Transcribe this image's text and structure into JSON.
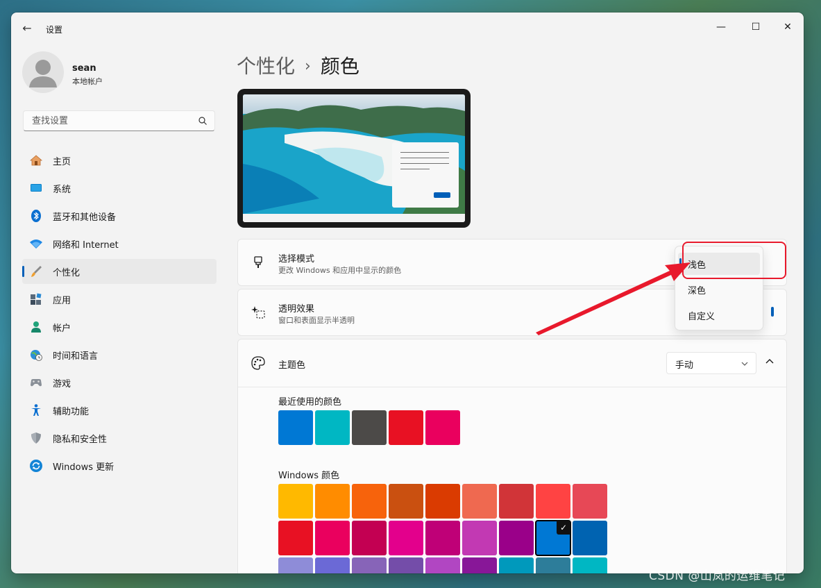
{
  "window": {
    "title": "设置",
    "back_glyph": "←",
    "minimize_glyph": "—",
    "maximize_glyph": "☐",
    "close_glyph": "✕"
  },
  "user": {
    "name": "sean",
    "account_type": "本地帐户"
  },
  "search": {
    "placeholder": "查找设置"
  },
  "sidebar": {
    "items": [
      {
        "label": "主页",
        "icon": "home-icon"
      },
      {
        "label": "系统",
        "icon": "display-icon"
      },
      {
        "label": "蓝牙和其他设备",
        "icon": "bluetooth-icon"
      },
      {
        "label": "网络和 Internet",
        "icon": "wifi-icon"
      },
      {
        "label": "个性化",
        "icon": "brush-icon",
        "active": true
      },
      {
        "label": "应用",
        "icon": "apps-icon"
      },
      {
        "label": "帐户",
        "icon": "person-icon"
      },
      {
        "label": "时间和语言",
        "icon": "globe-clock-icon"
      },
      {
        "label": "游戏",
        "icon": "gamepad-icon"
      },
      {
        "label": "辅助功能",
        "icon": "accessibility-icon"
      },
      {
        "label": "隐私和安全性",
        "icon": "shield-icon"
      },
      {
        "label": "Windows 更新",
        "icon": "update-icon"
      }
    ]
  },
  "breadcrumb": {
    "parent": "个性化",
    "separator": "›",
    "current": "颜色"
  },
  "mode_card": {
    "title": "选择模式",
    "description": "更改 Windows 和应用中显示的颜色"
  },
  "mode_flyout": {
    "options": [
      "浅色",
      "深色",
      "自定义"
    ],
    "selected": "浅色"
  },
  "transparency_card": {
    "title": "透明效果",
    "description": "窗口和表面显示半透明"
  },
  "accent_card": {
    "title": "主题色",
    "dropdown_value": "手动",
    "recent_label": "最近使用的颜色",
    "recent_colors": [
      "#0078d4",
      "#00b7c3",
      "#4c4a48",
      "#e81123",
      "#ea005e"
    ],
    "windows_label": "Windows 颜色",
    "windows_colors": [
      [
        "#ffb900",
        "#ff8c00",
        "#f7630c",
        "#ca5010",
        "#da3b01",
        "#ef6950",
        "#d13438",
        "#ff4343",
        "#e74856"
      ],
      [
        "#e81123",
        "#ea005e",
        "#c30052",
        "#e3008c",
        "#bf0077",
        "#c239b3",
        "#9a0089",
        "#0078d4",
        "#0063b1"
      ],
      [
        "#8e8cd8",
        "#6b69d6",
        "#8764b8",
        "#744da9",
        "#b146c2",
        "#881798",
        "#0099bc",
        "#2d7d9a",
        "#00b7c3"
      ]
    ],
    "selected_color": "#0078d4",
    "check_glyph": "✓"
  },
  "accent_color": "#005fb8",
  "watermark": "CSDN @山岚的运维笔记"
}
